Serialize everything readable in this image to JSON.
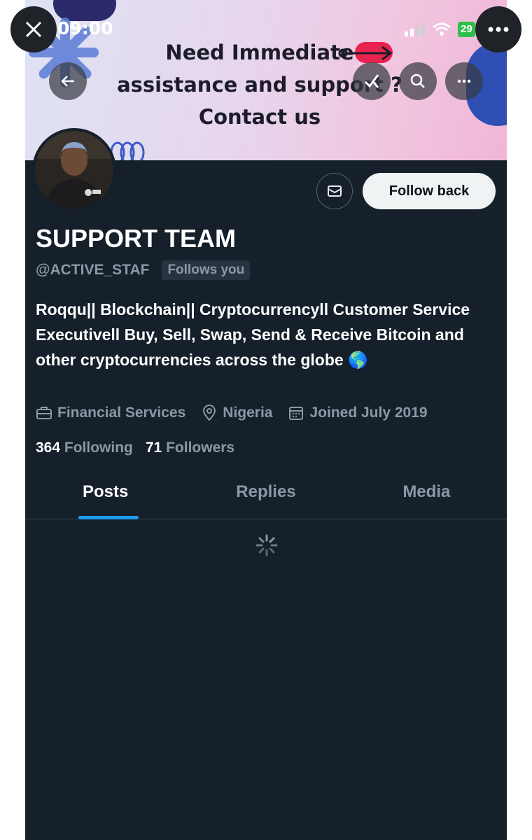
{
  "status_bar": {
    "time": "09:00",
    "battery": "29"
  },
  "banner": {
    "line1": "Need Immediate",
    "line2": "assistance and support ?",
    "line3": "Contact us"
  },
  "profile": {
    "name": "SUPPORT TEAM",
    "handle": "@ACTIVE_STAF",
    "follows_you": "Follows you",
    "bio": "Roqqu|| Blockchain|| Cryptocurrencyll Customer Service Executivell Buy, Sell, Swap, Send & Receive Bitcoin and other cryptocurrencies across the globe 🌎",
    "category": "Financial Services",
    "location": "Nigeria",
    "joined": "Joined July 2019",
    "following_count": "364",
    "following_label": "Following",
    "followers_count": "71",
    "followers_label": "Followers"
  },
  "actions": {
    "follow_back": "Follow back"
  },
  "tabs": [
    {
      "label": "Posts",
      "active": true
    },
    {
      "label": "Replies",
      "active": false
    },
    {
      "label": "Media",
      "active": false
    }
  ],
  "colors": {
    "background": "#15202b",
    "accent": "#1d9bf0",
    "muted_text": "#8b98a5"
  }
}
